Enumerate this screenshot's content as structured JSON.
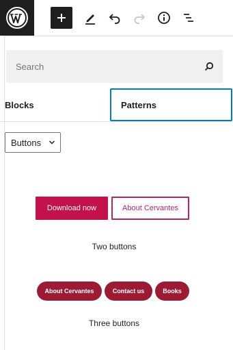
{
  "toolbar": {
    "logo_icon": "wordpress-logo-icon",
    "add_icon": "plus-icon",
    "edit_icon": "pencil-icon",
    "undo_icon": "undo-icon",
    "redo_icon": "redo-icon",
    "info_icon": "info-icon",
    "list_icon": "list-view-icon"
  },
  "inserter": {
    "search": {
      "placeholder": "Search",
      "value": "",
      "icon": "search-icon"
    },
    "tabs": [
      {
        "label": "Blocks",
        "active": false
      },
      {
        "label": "Patterns",
        "active": true
      }
    ],
    "category_select": {
      "value": "Buttons"
    },
    "patterns": [
      {
        "buttons": [
          "Download now",
          "About Cervantes"
        ],
        "title": "Two buttons"
      },
      {
        "buttons": [
          "About Cervantes",
          "Contact us",
          "Books"
        ],
        "title": "Three buttons"
      }
    ]
  },
  "colors": {
    "toolbar_dark": "#1e1e1e",
    "accent_focus": "#007cba",
    "button_primary": "#c2114c",
    "button_outline": "#b8255f",
    "pill": "#9d1a35"
  }
}
